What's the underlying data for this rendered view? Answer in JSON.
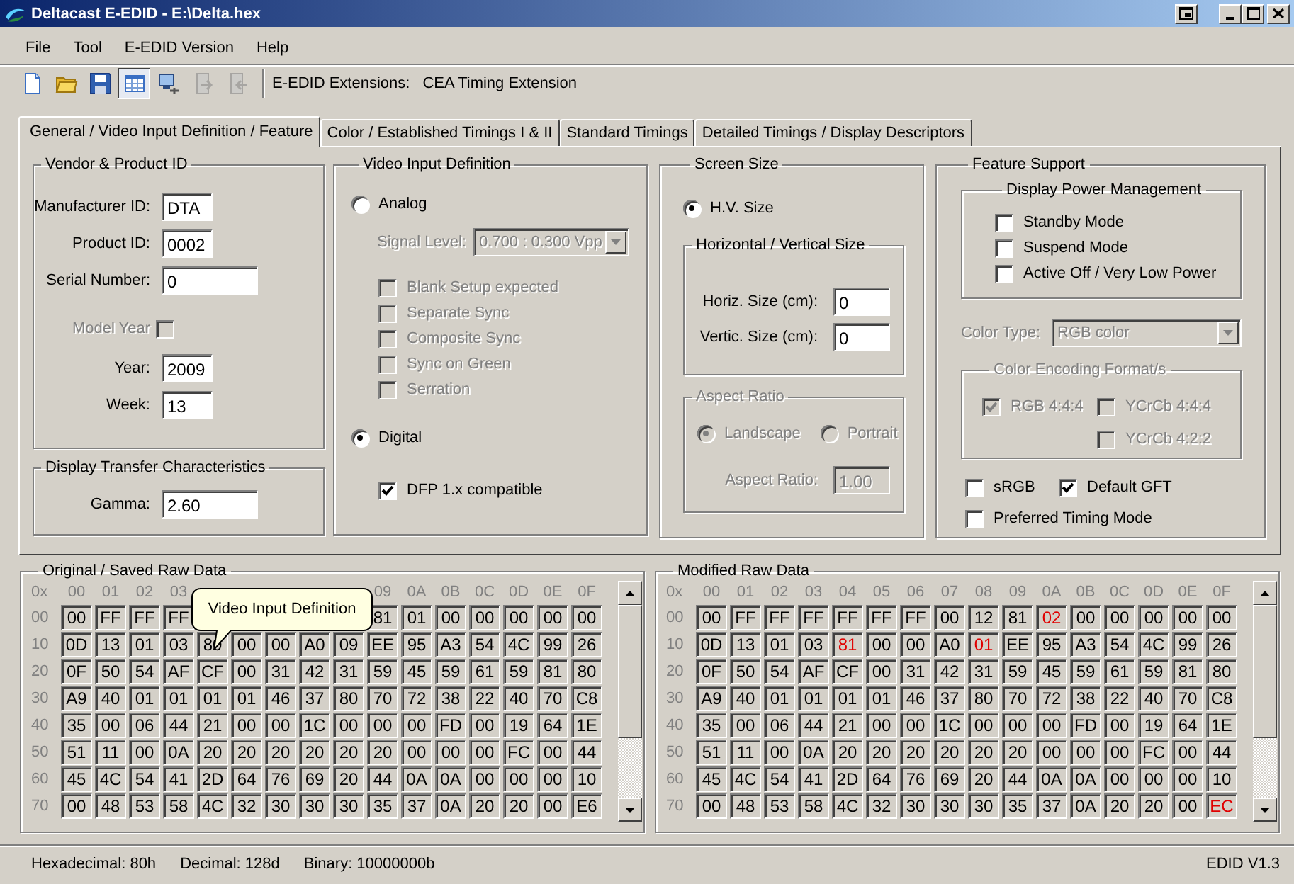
{
  "window": {
    "title": "Deltacast E-EDID - E:\\Delta.hex",
    "buttons": [
      {
        "kind": "pin"
      },
      {
        "kind": "minimize"
      },
      {
        "kind": "maximize"
      },
      {
        "kind": "close"
      }
    ]
  },
  "menu": [
    "File",
    "Tool",
    "E-EDID Version",
    "Help"
  ],
  "toolbar": {
    "buttons": [
      {
        "kind": "new",
        "selected": false,
        "disabled": false
      },
      {
        "kind": "open",
        "selected": false,
        "disabled": false
      },
      {
        "kind": "save",
        "selected": false,
        "disabled": false
      },
      {
        "kind": "table",
        "selected": true,
        "disabled": false
      },
      {
        "kind": "monitor",
        "selected": false,
        "disabled": false
      },
      {
        "kind": "export",
        "selected": false,
        "disabled": true
      },
      {
        "kind": "import",
        "selected": false,
        "disabled": true
      }
    ],
    "extensions_label": "E-EDID Extensions:",
    "extensions_value": "CEA Timing Extension"
  },
  "tabs": [
    {
      "label": "General / Video Input Definition / Feature",
      "selected": true
    },
    {
      "label": "Color / Established Timings I & II",
      "selected": false
    },
    {
      "label": "Standard Timings",
      "selected": false
    },
    {
      "label": "Detailed Timings / Display Descriptors",
      "selected": false
    }
  ],
  "vendor": {
    "title": "Vendor & Product ID",
    "manufacturer_id": {
      "label": "Manufacturer ID:",
      "value": "DTA"
    },
    "product_id": {
      "label": "Product ID:",
      "value": "0002"
    },
    "serial_number": {
      "label": "Serial Number:",
      "value": "0"
    },
    "model_year": {
      "label": "Model Year",
      "checked": false,
      "disabled": true
    },
    "year": {
      "label": "Year:",
      "value": "2009"
    },
    "week": {
      "label": "Week:",
      "value": "13"
    }
  },
  "transfer": {
    "title": "Display Transfer Characteristics",
    "gamma": {
      "label": "Gamma:",
      "value": "2.60"
    }
  },
  "video_input": {
    "title": "Video Input Definition",
    "analog": {
      "label": "Analog",
      "selected": false
    },
    "signal_level": {
      "label": "Signal Level:",
      "value": "0.700 : 0.300 Vpp",
      "disabled": true
    },
    "analog_options": [
      {
        "label": "Blank Setup expected",
        "checked": false,
        "disabled": true
      },
      {
        "label": "Separate Sync",
        "checked": false,
        "disabled": true
      },
      {
        "label": "Composite Sync",
        "checked": false,
        "disabled": true
      },
      {
        "label": "Sync on Green",
        "checked": false,
        "disabled": true
      },
      {
        "label": "Serration",
        "checked": false,
        "disabled": true
      }
    ],
    "digital": {
      "label": "Digital",
      "selected": true
    },
    "dfp": {
      "label": "DFP 1.x compatible",
      "checked": true
    }
  },
  "screen_size": {
    "title": "Screen Size",
    "hv_size": {
      "label": "H.V. Size",
      "selected": true
    },
    "hv_group": {
      "title": "Horizontal / Vertical Size",
      "horizontal": {
        "label": "Horiz. Size (cm):",
        "value": "0"
      },
      "vertical": {
        "label": "Vertic. Size (cm):",
        "value": "0"
      }
    },
    "aspect_group": {
      "title": "Aspect Ratio",
      "disabled": true,
      "landscape": {
        "label": "Landscape",
        "selected": true
      },
      "portrait": {
        "label": "Portrait",
        "selected": false
      },
      "aspect_ratio": {
        "label": "Aspect Ratio:",
        "value": "1.00"
      }
    }
  },
  "feature": {
    "title": "Feature Support",
    "power_group": {
      "title": "Display Power Management",
      "options": [
        {
          "label": "Standby Mode",
          "checked": false
        },
        {
          "label": "Suspend Mode",
          "checked": false
        },
        {
          "label": "Active Off / Very Low Power",
          "checked": false
        }
      ]
    },
    "color_type": {
      "label": "Color Type:",
      "value": "RGB color",
      "disabled": true
    },
    "encoding_group": {
      "title": "Color Encoding Format/s",
      "disabled": true,
      "options": [
        {
          "label": "RGB 4:4:4",
          "checked": true,
          "disabled": true
        },
        {
          "label": "YCrCb 4:4:4",
          "checked": false,
          "disabled": true
        },
        {
          "label": "YCrCb 4:2:2",
          "checked": false,
          "disabled": true
        }
      ]
    },
    "options": [
      {
        "label": "sRGB",
        "checked": false
      },
      {
        "label": "Default GFT",
        "checked": true
      },
      {
        "label": "Preferred Timing Mode",
        "checked": false
      }
    ]
  },
  "raw_data": [
    {
      "title": "Original / Saved Raw Data",
      "tooltip": "Video Input Definition",
      "corner": "0x",
      "columns": [
        "00",
        "01",
        "02",
        "03",
        null,
        null,
        null,
        null,
        null,
        "09",
        "0A",
        "0B",
        "0C",
        "0D",
        "0E",
        "0F"
      ],
      "rows": [
        {
          "label": "00",
          "cells": [
            "00",
            "FF",
            "FF",
            "FF",
            null,
            null,
            null,
            null,
            null,
            "81",
            "01",
            "00",
            "00",
            "00",
            "00",
            "00"
          ]
        },
        {
          "label": "10",
          "cells": [
            "0D",
            "13",
            "01",
            "03",
            "80",
            "00",
            "00",
            "A0",
            "09",
            "EE",
            "95",
            "A3",
            "54",
            "4C",
            "99",
            "26"
          ]
        },
        {
          "label": "20",
          "cells": [
            "0F",
            "50",
            "54",
            "AF",
            "CF",
            "00",
            "31",
            "42",
            "31",
            "59",
            "45",
            "59",
            "61",
            "59",
            "81",
            "80"
          ]
        },
        {
          "label": "30",
          "cells": [
            "A9",
            "40",
            "01",
            "01",
            "01",
            "01",
            "46",
            "37",
            "80",
            "70",
            "72",
            "38",
            "22",
            "40",
            "70",
            "C8"
          ]
        },
        {
          "label": "40",
          "cells": [
            "35",
            "00",
            "06",
            "44",
            "21",
            "00",
            "00",
            "1C",
            "00",
            "00",
            "00",
            "FD",
            "00",
            "19",
            "64",
            "1E"
          ]
        },
        {
          "label": "50",
          "cells": [
            "51",
            "11",
            "00",
            "0A",
            "20",
            "20",
            "20",
            "20",
            "20",
            "20",
            "00",
            "00",
            "00",
            "FC",
            "00",
            "44"
          ]
        },
        {
          "label": "60",
          "cells": [
            "45",
            "4C",
            "54",
            "41",
            "2D",
            "64",
            "76",
            "69",
            "20",
            "44",
            "0A",
            "0A",
            "00",
            "00",
            "00",
            "10"
          ]
        },
        {
          "label": "70",
          "cells": [
            "00",
            "48",
            "53",
            "58",
            "4C",
            "32",
            "30",
            "30",
            "30",
            "35",
            "37",
            "0A",
            "20",
            "20",
            "00",
            "E6"
          ]
        }
      ]
    },
    {
      "title": "Modified Raw Data",
      "corner": "0x",
      "columns": [
        "00",
        "01",
        "02",
        "03",
        "04",
        "05",
        "06",
        "07",
        "08",
        "09",
        "0A",
        "0B",
        "0C",
        "0D",
        "0E",
        "0F"
      ],
      "rows": [
        {
          "label": "00",
          "cells": [
            "00",
            "FF",
            "FF",
            "FF",
            "FF",
            "FF",
            "FF",
            "00",
            "12",
            "81",
            "02",
            "00",
            "00",
            "00",
            "00",
            "00"
          ],
          "changed": [
            false,
            false,
            false,
            false,
            false,
            false,
            false,
            false,
            false,
            false,
            true,
            false,
            false,
            false,
            false,
            false
          ]
        },
        {
          "label": "10",
          "cells": [
            "0D",
            "13",
            "01",
            "03",
            "81",
            "00",
            "00",
            "A0",
            "01",
            "EE",
            "95",
            "A3",
            "54",
            "4C",
            "99",
            "26"
          ],
          "changed": [
            false,
            false,
            false,
            false,
            true,
            false,
            false,
            false,
            true,
            false,
            false,
            false,
            false,
            false,
            false,
            false
          ]
        },
        {
          "label": "20",
          "cells": [
            "0F",
            "50",
            "54",
            "AF",
            "CF",
            "00",
            "31",
            "42",
            "31",
            "59",
            "45",
            "59",
            "61",
            "59",
            "81",
            "80"
          ],
          "changed": [
            false,
            false,
            false,
            false,
            false,
            false,
            false,
            false,
            false,
            false,
            false,
            false,
            false,
            false,
            false,
            false
          ]
        },
        {
          "label": "30",
          "cells": [
            "A9",
            "40",
            "01",
            "01",
            "01",
            "01",
            "46",
            "37",
            "80",
            "70",
            "72",
            "38",
            "22",
            "40",
            "70",
            "C8"
          ],
          "changed": [
            false,
            false,
            false,
            false,
            false,
            false,
            false,
            false,
            false,
            false,
            false,
            false,
            false,
            false,
            false,
            false
          ]
        },
        {
          "label": "40",
          "cells": [
            "35",
            "00",
            "06",
            "44",
            "21",
            "00",
            "00",
            "1C",
            "00",
            "00",
            "00",
            "FD",
            "00",
            "19",
            "64",
            "1E"
          ],
          "changed": [
            false,
            false,
            false,
            false,
            false,
            false,
            false,
            false,
            false,
            false,
            false,
            false,
            false,
            false,
            false,
            false
          ]
        },
        {
          "label": "50",
          "cells": [
            "51",
            "11",
            "00",
            "0A",
            "20",
            "20",
            "20",
            "20",
            "20",
            "20",
            "00",
            "00",
            "00",
            "FC",
            "00",
            "44"
          ],
          "changed": [
            false,
            false,
            false,
            false,
            false,
            false,
            false,
            false,
            false,
            false,
            false,
            false,
            false,
            false,
            false,
            false
          ]
        },
        {
          "label": "60",
          "cells": [
            "45",
            "4C",
            "54",
            "41",
            "2D",
            "64",
            "76",
            "69",
            "20",
            "44",
            "0A",
            "0A",
            "00",
            "00",
            "00",
            "10"
          ],
          "changed": [
            false,
            false,
            false,
            false,
            false,
            false,
            false,
            false,
            false,
            false,
            false,
            false,
            false,
            false,
            false,
            false
          ]
        },
        {
          "label": "70",
          "cells": [
            "00",
            "48",
            "53",
            "58",
            "4C",
            "32",
            "30",
            "30",
            "30",
            "35",
            "37",
            "0A",
            "20",
            "20",
            "00",
            "EC"
          ],
          "changed": [
            false,
            false,
            false,
            false,
            false,
            false,
            false,
            false,
            false,
            false,
            false,
            false,
            false,
            false,
            false,
            true
          ]
        }
      ]
    }
  ],
  "status_bar": {
    "items": [
      "Hexadecimal: 80h",
      "Decimal: 128d",
      "Binary: 10000000b"
    ],
    "version": "EDID V1.3"
  }
}
